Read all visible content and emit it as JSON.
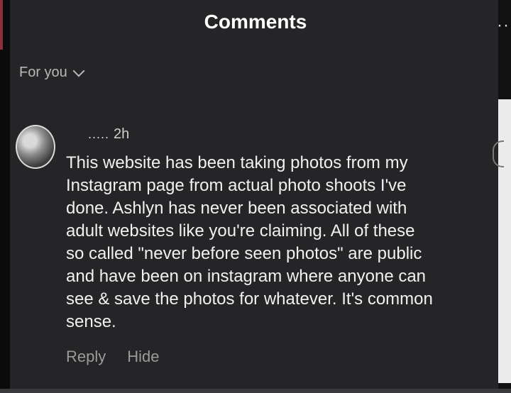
{
  "header": {
    "title": "Comments"
  },
  "filter": {
    "label": "For you"
  },
  "comment": {
    "username": ".....",
    "time": "2h",
    "text": "This website has been taking photos from my\nInstagram page from actual photo shoots I've\ndone. Ashlyn has never been associated with\nadult websites like you're claiming. All of these\nso called \"never before seen photos\" are public\nand have been on instagram where anyone can\nsee & save the photos for whatever. It's common\nsense.",
    "actions": {
      "reply": "Reply",
      "hide": "Hide"
    }
  },
  "icons": {
    "header_more": "more-dots-icon",
    "filter_chevron": "chevron-down-icon"
  }
}
